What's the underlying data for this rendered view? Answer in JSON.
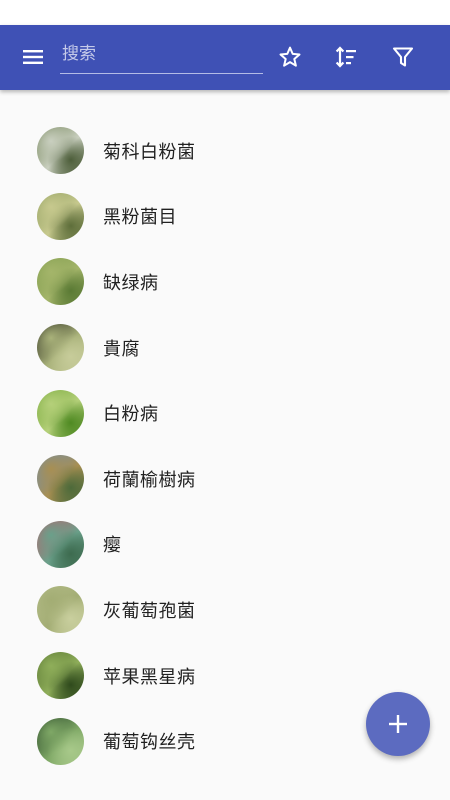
{
  "toolbar": {
    "menu_icon": "menu-icon",
    "search_placeholder": "搜索",
    "star_icon": "star-outline-icon",
    "sort_icon": "sort-icon",
    "filter_icon": "filter-icon",
    "color": "#3f51b5"
  },
  "items": [
    {
      "label": "菊科白粉菌",
      "thumb_colors": [
        "#6b7d4f",
        "#c9cfbf",
        "#4d5e3a"
      ]
    },
    {
      "label": "黑粉菌目",
      "thumb_colors": [
        "#8a9a5b",
        "#c7c98e",
        "#5e6e3a"
      ]
    },
    {
      "label": "缺绿病",
      "thumb_colors": [
        "#7c9a4a",
        "#a4b56a",
        "#5a7a34"
      ]
    },
    {
      "label": "貴腐",
      "thumb_colors": [
        "#1c1c14",
        "#a9b27a",
        "#c7cc9a"
      ]
    },
    {
      "label": "白粉病",
      "thumb_colors": [
        "#6ea332",
        "#b5d07a",
        "#4f8a22"
      ]
    },
    {
      "label": "荷蘭榆樹病",
      "thumb_colors": [
        "#6a8fb8",
        "#a88f52",
        "#4d6a3a"
      ]
    },
    {
      "label": "瘿",
      "thumb_colors": [
        "#c45a6a",
        "#6aa08a",
        "#3d6b4f"
      ]
    },
    {
      "label": "灰葡萄孢菌",
      "thumb_colors": [
        "#b7bf8c",
        "#a3ad74",
        "#c9cf9e"
      ]
    },
    {
      "label": "苹果黑星病",
      "thumb_colors": [
        "#4e6b2a",
        "#8fae5a",
        "#2f4a1c"
      ]
    },
    {
      "label": "葡萄钩丝壳",
      "thumb_colors": [
        "#1d3a20",
        "#7fa866",
        "#a8c98a"
      ]
    }
  ],
  "fab": {
    "icon": "plus-icon",
    "color": "#5c6bc0"
  }
}
